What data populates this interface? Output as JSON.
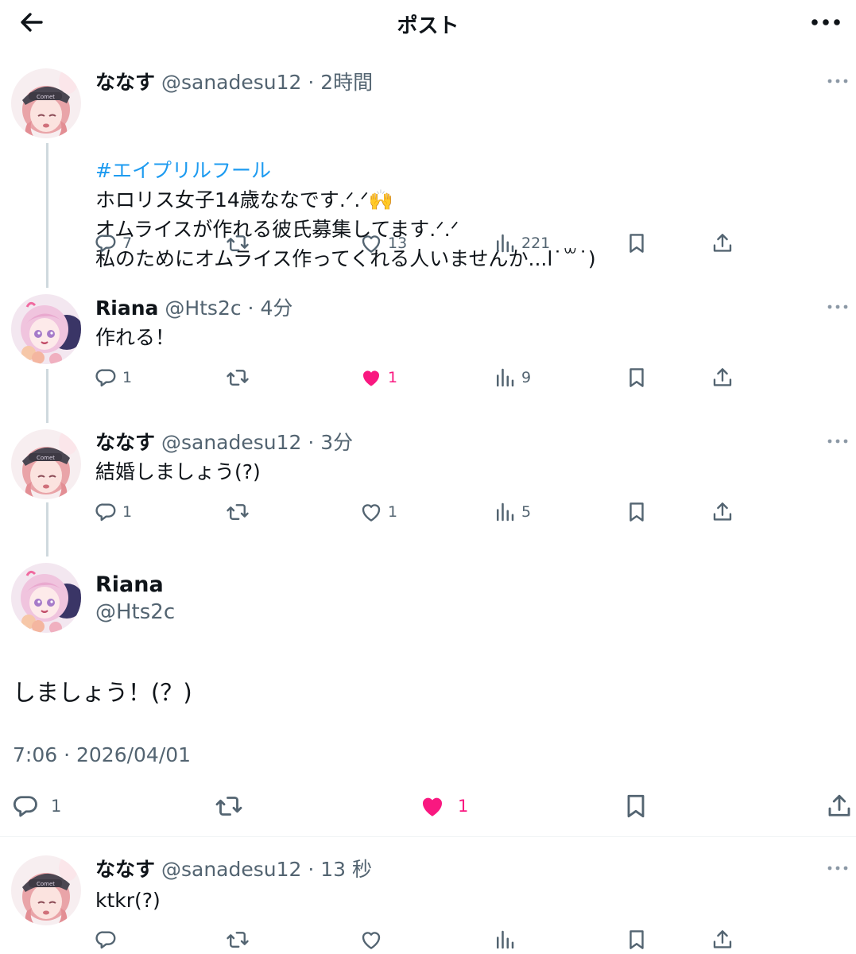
{
  "header": {
    "title": "ポスト"
  },
  "tweets": [
    {
      "name": "ななす",
      "handle": "@sanadesu12",
      "dot": "·",
      "time": "2時間",
      "hashtag": "#エイプリルフール",
      "text": "ホロリス女子14歳ななです.ᐟ.ᐟ🙌\nオムライスが作れる彼氏募集してます.ᐟ.ᐟ\n私のためにオムライス作ってくれる人いませんか...l˙꒳˙)",
      "replies": "7",
      "retweets": "",
      "likes": "13",
      "liked": false,
      "views": "221"
    },
    {
      "name": "Riana",
      "handle": "@Hts2c",
      "dot": "·",
      "time": "4分",
      "text": "作れる！",
      "replies": "1",
      "retweets": "",
      "likes": "1",
      "liked": true,
      "views": "9"
    },
    {
      "name": "ななす",
      "handle": "@sanadesu12",
      "dot": "·",
      "time": "3分",
      "text": "結婚しましょう(?)",
      "replies": "1",
      "retweets": "",
      "likes": "1",
      "liked": false,
      "views": "5"
    }
  ],
  "main": {
    "name": "Riana",
    "handle": "@Hts2c",
    "text": "しましょう！(？)",
    "timestamp": "7:06 · 2026/04/01",
    "replies": "1",
    "likes": "1",
    "liked": true
  },
  "reply": {
    "name": "ななす",
    "handle": "@sanadesu12",
    "dot": "·",
    "time": "13 秒",
    "text": "ktkr(?)"
  },
  "colors": {
    "text": "#0f1419",
    "secondary": "#536471",
    "link": "#1d9bf0",
    "like": "#f91880",
    "thread_line": "#cfd9de"
  },
  "icons": {
    "back": "arrow-left-icon",
    "more": "more-horizontal-icon",
    "reply": "reply-icon",
    "retweet": "retweet-icon",
    "like": "heart-icon",
    "views": "views-icon",
    "bookmark": "bookmark-icon",
    "share": "share-icon"
  }
}
